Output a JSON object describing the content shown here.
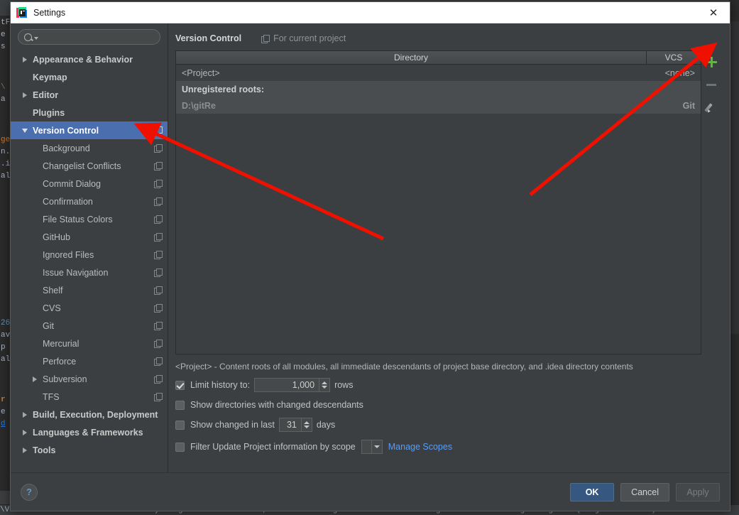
{
  "window": {
    "title": "Settings",
    "icon": "intellij-idea-icon",
    "close_label": "✕"
  },
  "search": {
    "placeholder": "",
    "value": "",
    "icon": "search-icon",
    "dropdown_icon": "chevron-down-icon"
  },
  "sidebar": {
    "items": [
      {
        "label": "Appearance & Behavior",
        "level": "top",
        "expander": "right",
        "selected": false,
        "copy_icon": false
      },
      {
        "label": "Keymap",
        "level": "top",
        "expander": "none",
        "selected": false,
        "copy_icon": false
      },
      {
        "label": "Editor",
        "level": "top",
        "expander": "right",
        "selected": false,
        "copy_icon": false
      },
      {
        "label": "Plugins",
        "level": "top",
        "expander": "none",
        "selected": false,
        "copy_icon": false
      },
      {
        "label": "Version Control",
        "level": "top",
        "expander": "down",
        "selected": true,
        "copy_icon": true
      },
      {
        "label": "Background",
        "level": "child",
        "expander": "none",
        "selected": false,
        "copy_icon": true
      },
      {
        "label": "Changelist Conflicts",
        "level": "child",
        "expander": "none",
        "selected": false,
        "copy_icon": true
      },
      {
        "label": "Commit Dialog",
        "level": "child",
        "expander": "none",
        "selected": false,
        "copy_icon": true
      },
      {
        "label": "Confirmation",
        "level": "child",
        "expander": "none",
        "selected": false,
        "copy_icon": true
      },
      {
        "label": "File Status Colors",
        "level": "child",
        "expander": "none",
        "selected": false,
        "copy_icon": true
      },
      {
        "label": "GitHub",
        "level": "child",
        "expander": "none",
        "selected": false,
        "copy_icon": true
      },
      {
        "label": "Ignored Files",
        "level": "child",
        "expander": "none",
        "selected": false,
        "copy_icon": true
      },
      {
        "label": "Issue Navigation",
        "level": "child",
        "expander": "none",
        "selected": false,
        "copy_icon": true
      },
      {
        "label": "Shelf",
        "level": "child",
        "expander": "none",
        "selected": false,
        "copy_icon": true
      },
      {
        "label": "CVS",
        "level": "child",
        "expander": "none",
        "selected": false,
        "copy_icon": true
      },
      {
        "label": "Git",
        "level": "child",
        "expander": "none",
        "selected": false,
        "copy_icon": true
      },
      {
        "label": "Mercurial",
        "level": "child",
        "expander": "none",
        "selected": false,
        "copy_icon": true
      },
      {
        "label": "Perforce",
        "level": "child",
        "expander": "none",
        "selected": false,
        "copy_icon": true
      },
      {
        "label": "Subversion",
        "level": "child",
        "expander": "right",
        "selected": false,
        "copy_icon": true
      },
      {
        "label": "TFS",
        "level": "child",
        "expander": "none",
        "selected": false,
        "copy_icon": true
      },
      {
        "label": "Build, Execution, Deployment",
        "level": "top",
        "expander": "right",
        "selected": false,
        "copy_icon": false
      },
      {
        "label": "Languages & Frameworks",
        "level": "top",
        "expander": "right",
        "selected": false,
        "copy_icon": false
      },
      {
        "label": "Tools",
        "level": "top",
        "expander": "right",
        "selected": false,
        "copy_icon": false
      }
    ]
  },
  "main": {
    "title": "Version Control",
    "scope_label": "For current project",
    "scope_icon": "copy-settings-icon",
    "table": {
      "columns": [
        "Directory",
        "VCS"
      ],
      "rows": [
        {
          "directory": "<Project>",
          "vcs": "<none>",
          "style": "dim",
          "alt": false
        },
        {
          "directory": "Unregistered roots:",
          "vcs": "",
          "style": "bold",
          "alt": true
        },
        {
          "directory": "D:\\gitRe",
          "vcs": "Git",
          "style": "gray",
          "alt": true
        }
      ]
    },
    "toolbar": {
      "add_label": "+",
      "add_icon": "plus-icon",
      "remove_icon": "minus-icon",
      "edit_icon": "pencil-icon"
    },
    "hint": "<Project> - Content roots of all modules, all immediate descendants of project base directory, and .idea directory contents",
    "options": {
      "limit_history": {
        "label": "Limit history to:",
        "checked": true,
        "value": "1,000",
        "suffix": "rows"
      },
      "show_dirs_changed_descendants": {
        "label": "Show directories with changed descendants",
        "checked": false
      },
      "show_changed_in_last": {
        "label": "Show changed in last",
        "checked": false,
        "value": "31",
        "suffix": "days"
      },
      "filter_update_by_scope": {
        "label": "Filter Update Project information by scope",
        "checked": false,
        "scope_value": "",
        "manage_scopes_link": "Manage Scopes"
      }
    }
  },
  "footer": {
    "help_label": "?",
    "ok_label": "OK",
    "cancel_label": "Cancel",
    "apply_label": "Apply"
  },
  "background": {
    "editor_fragments": [
      "tF",
      "e",
      "s",
      "\\",
      "a",
      "ge",
      "n.",
      ".i",
      "al",
      "26",
      "av",
      "p",
      "al",
      "r",
      "e",
      "d"
    ],
    "status_line": "\\VCS roots detected: The directory D:\\gitRe is under Git, but is not registered in the Settings. Add root   Configure    Ignore  (Project vcs.xml)"
  },
  "colors": {
    "accent_blue": "#4b6eaf",
    "link_blue": "#589df6",
    "add_green": "#62b543",
    "primary_button": "#365880",
    "arrow_red": "#f01000",
    "panel_bg": "#3c3f41",
    "titlebar_bg": "#ffffff"
  }
}
